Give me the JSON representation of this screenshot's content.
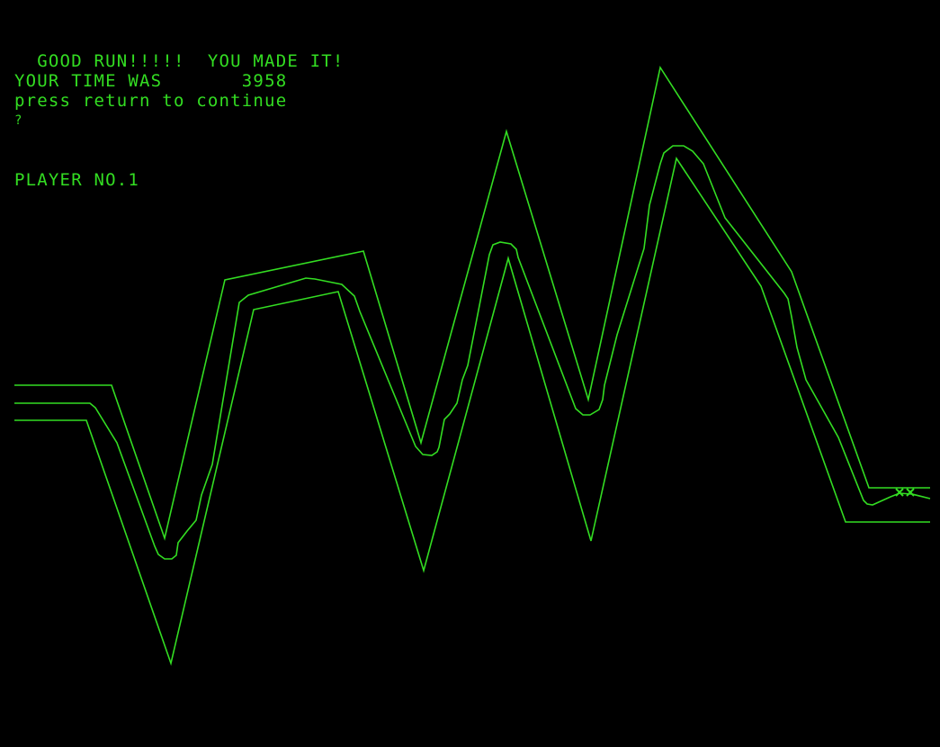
{
  "terminal": {
    "result_message": "  GOOD RUN!!!!!  YOU MADE IT!",
    "time_label": "YOUR TIME WAS",
    "time_value": "3958",
    "prompt": "press return to continue",
    "cursor": "?",
    "player": "PLAYER NO.1"
  },
  "colors": {
    "background": "#000000",
    "phosphor": "#33dd22"
  },
  "icons": {
    "finish_marker": "crossed-flags-icon"
  }
}
